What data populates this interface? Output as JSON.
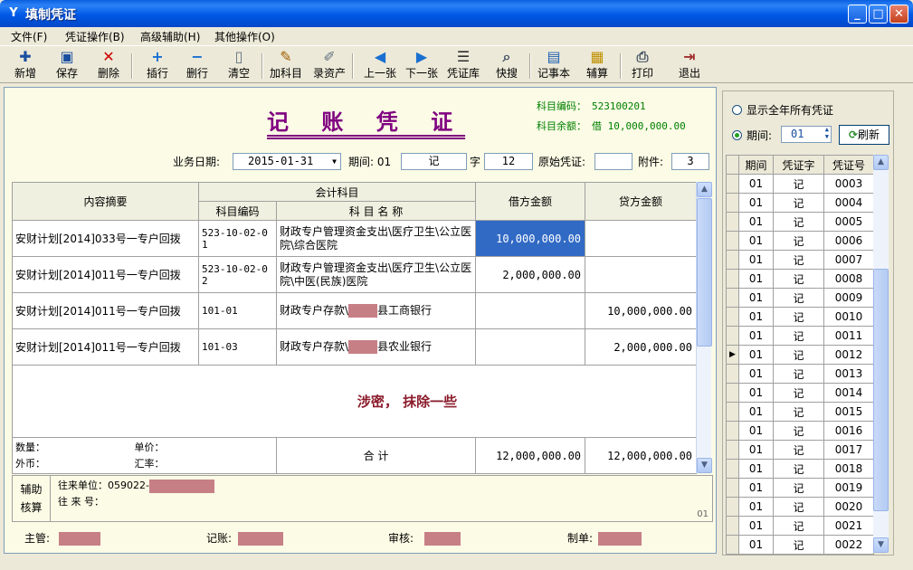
{
  "window": {
    "app_icon": "Y",
    "title": "填制凭证"
  },
  "menu": [
    "文件(F)",
    "凭证操作(B)",
    "高级辅助(H)",
    "其他操作(O)"
  ],
  "toolbar": [
    {
      "label": "新增",
      "icon": "add-doc-icon",
      "glyph": "✚"
    },
    {
      "label": "保存",
      "icon": "save-icon",
      "glyph": "▣"
    },
    {
      "label": "删除",
      "icon": "delete-icon",
      "glyph": "✕"
    },
    {
      "label": "插行",
      "icon": "insert-row-icon",
      "glyph": "+"
    },
    {
      "label": "删行",
      "icon": "delete-row-icon",
      "glyph": "−"
    },
    {
      "label": "清空",
      "icon": "clear-icon",
      "glyph": "▯"
    },
    {
      "label": "加科目",
      "icon": "add-subject-icon",
      "glyph": "✎"
    },
    {
      "label": "录资产",
      "icon": "record-asset-icon",
      "glyph": "✐"
    },
    {
      "label": "上一张",
      "icon": "arrow-left-icon",
      "glyph": "◀"
    },
    {
      "label": "下一张",
      "icon": "arrow-right-icon",
      "glyph": "▶"
    },
    {
      "label": "凭证库",
      "icon": "voucher-library-icon",
      "glyph": "☰"
    },
    {
      "label": "快搜",
      "icon": "quick-search-icon",
      "glyph": "⌕"
    },
    {
      "label": "记事本",
      "icon": "notepad-icon",
      "glyph": "▤"
    },
    {
      "label": "辅算",
      "icon": "calculator-icon",
      "glyph": "▦"
    },
    {
      "label": "打印",
      "icon": "print-icon",
      "glyph": "⎙"
    },
    {
      "label": "退出",
      "icon": "exit-icon",
      "glyph": "⇥"
    }
  ],
  "voucher": {
    "title": "记 账 凭 证",
    "account_code_label": "科目编码：",
    "account_code": "523100201",
    "account_balance_label": "科目余额：",
    "account_balance": "借 10,000,000.00",
    "date_label": "业务日期:",
    "date": "2015-01-31",
    "period_label": "期间: 01",
    "voucher_type": "记",
    "zi_label": "字",
    "voucher_no": "12",
    "original_label": "原始凭证:",
    "original_value": "",
    "attach_label": "附件:",
    "attach_value": "3",
    "headers": {
      "summary": "内容摘要",
      "subject": "会计科目",
      "subject_code": "科目编码",
      "subject_name": "科 目 名 称",
      "debit": "借方金额",
      "credit": "贷方金额"
    },
    "rows": [
      {
        "summary": "安财计划[2014]033号一专户回拨",
        "code": "523-10-02-01",
        "name": "财政专户管理资金支出\\医疗卫生\\公立医院\\综合医院",
        "name_pre": "",
        "name_post": "",
        "debit": "10,000,000.00",
        "credit": ""
      },
      {
        "summary": "安财计划[2014]011号一专户回拨",
        "code": "523-10-02-02",
        "name": "财政专户管理资金支出\\医疗卫生\\公立医院\\中医(民族)医院",
        "name_pre": "",
        "name_post": "",
        "debit": "2,000,000.00",
        "credit": ""
      },
      {
        "summary": "安财计划[2014]011号一专户回拨",
        "code": "101-01",
        "name": "",
        "name_pre": "财政专户存款\\",
        "name_post": "县工商银行",
        "debit": "",
        "credit": "10,000,000.00"
      },
      {
        "summary": "安财计划[2014]011号一专户回拨",
        "code": "101-03",
        "name": "",
        "name_pre": "财政专户存款\\",
        "name_post": "县农业银行",
        "debit": "",
        "credit": "2,000,000.00"
      }
    ],
    "note": "涉密， 抹除一些",
    "qty_label": "数量：",
    "price_label": "单价：",
    "currency_label": "外币：",
    "rate_label": "汇率：",
    "total_label": "合 计",
    "total_debit": "12,000,000.00",
    "total_credit": "12,000,000.00",
    "aux_label_1": "辅助",
    "aux_label_2": "核算",
    "counterparty_label": "往来单位：",
    "counterparty_prefix": "059022-",
    "contact_label": "往 来 号：",
    "aux_page": "01",
    "supervisor_label": "主管:",
    "bookkeeper_label": "记账:",
    "auditor_label": "审核:",
    "preparer_label": "制单:"
  },
  "side": {
    "show_all_label": "显示全年所有凭证",
    "period_label": "期间:",
    "period_value": "01",
    "refresh_label": "刷新",
    "headers": [
      "期间",
      "凭证字",
      "凭证号"
    ],
    "rows": [
      [
        "01",
        "记",
        "0003"
      ],
      [
        "01",
        "记",
        "0004"
      ],
      [
        "01",
        "记",
        "0005"
      ],
      [
        "01",
        "记",
        "0006"
      ],
      [
        "01",
        "记",
        "0007"
      ],
      [
        "01",
        "记",
        "0008"
      ],
      [
        "01",
        "记",
        "0009"
      ],
      [
        "01",
        "记",
        "0010"
      ],
      [
        "01",
        "记",
        "0011"
      ],
      [
        "01",
        "记",
        "0012"
      ],
      [
        "01",
        "记",
        "0013"
      ],
      [
        "01",
        "记",
        "0014"
      ],
      [
        "01",
        "记",
        "0015"
      ],
      [
        "01",
        "记",
        "0016"
      ],
      [
        "01",
        "记",
        "0017"
      ],
      [
        "01",
        "记",
        "0018"
      ],
      [
        "01",
        "记",
        "0019"
      ],
      [
        "01",
        "记",
        "0020"
      ],
      [
        "01",
        "记",
        "0021"
      ],
      [
        "01",
        "记",
        "0022"
      ]
    ],
    "current_index": 9
  },
  "colors": {
    "title_purple": "#800080",
    "account_green": "#008000",
    "selection_blue": "#316ac5",
    "redaction": "#c77f86",
    "note_red": "#8b1c2c"
  }
}
